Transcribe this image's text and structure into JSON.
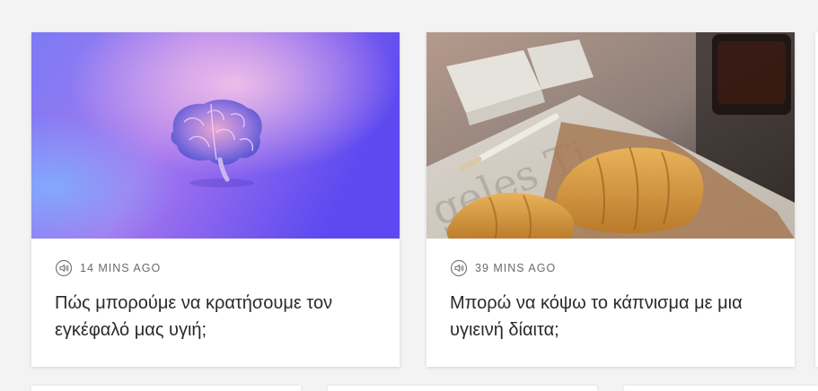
{
  "cards": [
    {
      "image_alt": "brain illustration on purple gradient",
      "time_icon": "audio-speaker-icon",
      "time": "14 MINS AGO",
      "title": "Πώς μπορούμε να κρατήσουμε τον εγκέφαλό μας υγιή;"
    },
    {
      "image_alt": "croissants with cigarettes on newspaper",
      "time_icon": "audio-speaker-icon",
      "time": "39 MINS AGO",
      "title": "Μπορώ να κόψω το κάπνισμα με μια υγιεινή δίαιτα;"
    }
  ]
}
